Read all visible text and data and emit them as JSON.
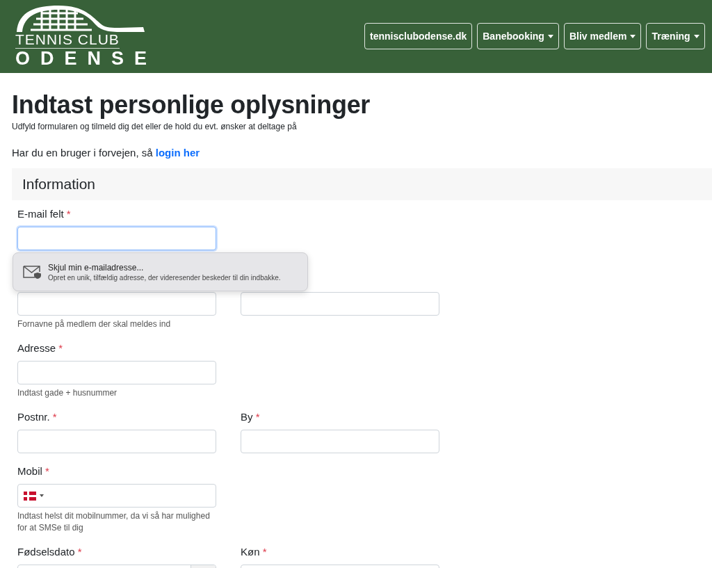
{
  "header": {
    "logo": {
      "line_1": "TENNIS CLUB",
      "line_2": "ODENSE"
    },
    "nav": [
      {
        "label": "tennisclubodense.dk",
        "dropdown": false
      },
      {
        "label": "Banebooking",
        "dropdown": true
      },
      {
        "label": "Bliv medlem",
        "dropdown": true
      },
      {
        "label": "Træning",
        "dropdown": true
      }
    ]
  },
  "page": {
    "title": "Indtast personlige oplysninger",
    "subtitle": "Udfyld formularen og tilmeld dig det eller de hold du evt. ønsker at deltage på",
    "login_text": "Har du en bruger i forvejen, så",
    "login_link": "login her"
  },
  "section": {
    "title": "Information"
  },
  "rows": [
    {
      "fields": [
        {
          "kind": "text",
          "label": "E-mail felt",
          "required": "*",
          "focused": true
        }
      ]
    },
    {
      "fields": [
        {
          "kind": "text",
          "help": "Fornavne på medlem der skal meldes ind",
          "focused": false
        },
        {
          "kind": "text",
          "focused": false
        }
      ]
    },
    {
      "fields": [
        {
          "kind": "text",
          "label": "Adresse",
          "required": "*",
          "help": "Indtast gade + husnummer",
          "focused": false
        }
      ]
    },
    {
      "fields": [
        {
          "kind": "text",
          "label": "Postnr.",
          "required": "*",
          "focused": false
        },
        {
          "kind": "text",
          "label": "By",
          "required": "*",
          "focused": false
        }
      ]
    },
    {
      "fields": [
        {
          "kind": "phone",
          "label": "Mobil",
          "required": "*",
          "help": "Indtast helst dit mobilnummer, da vi så har mulighed for at SMSe til dig",
          "focused": false
        }
      ]
    },
    {
      "fields": [
        {
          "kind": "date",
          "label": "Fødselsdato",
          "required": "*",
          "focused": false
        },
        {
          "kind": "text",
          "label": "Køn",
          "required": "*",
          "focused": false
        }
      ]
    }
  ],
  "autofill_popup": {
    "title": "Skjul min e-mailadresse...",
    "description": "Opret en unik, tilfældig adresse, der videresender beskeder til din indbakke."
  }
}
